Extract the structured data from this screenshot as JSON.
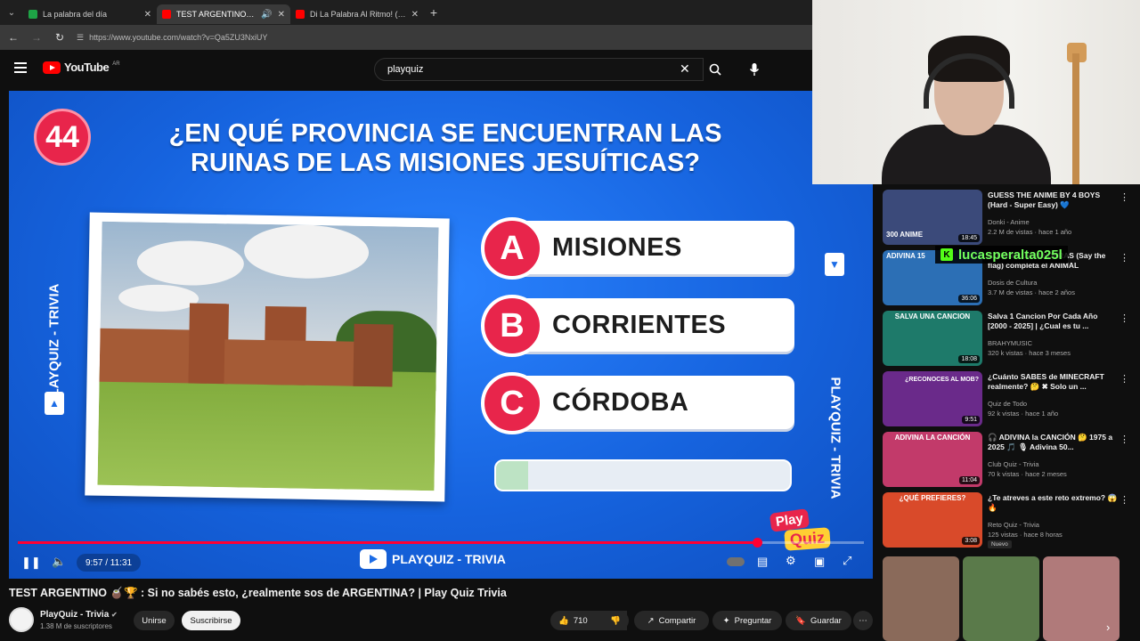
{
  "browser": {
    "tabs": [
      {
        "label": "La palabra del día",
        "color": "#1ea446"
      },
      {
        "label": "TEST ARGENTINO 🧉🏆 : S",
        "color": "#ff0000"
      },
      {
        "label": "Di La Palabra Al Ritmo! (Say Th",
        "color": "#ff0000"
      }
    ],
    "new_tab": "+",
    "url": "https://www.youtube.com/watch?v=Qa5ZU3NxiUY"
  },
  "youtube": {
    "logo": "YouTube",
    "country": "AR",
    "search_value": "playquiz"
  },
  "video": {
    "question_number": "44",
    "question_line1": "¿EN QUÉ PROVINCIA SE ENCUENTRAN LAS",
    "question_line2": "RUINAS DE LAS MISIONES JESUÍTICAS?",
    "side_text": "PLAYQUIZ - TRIVIA",
    "answers": [
      {
        "letter": "A",
        "text": "MISIONES"
      },
      {
        "letter": "B",
        "text": "CORRIENTES"
      },
      {
        "letter": "C",
        "text": "CÓRDOBA"
      }
    ],
    "timer_fraction": 0.11,
    "logo_line1": "Play",
    "logo_line2": "Quiz",
    "progress_fraction": 0.874,
    "time": "9:57 / 11:31",
    "channel_chip": "PLAYQUIZ - TRIVIA"
  },
  "below": {
    "title": "TEST ARGENTINO 🧉🏆 : Si no sabés esto, ¿realmente sos de ARGENTINA? | Play Quiz Trivia",
    "channel": "PlayQuiz - Trivia",
    "subscribers": "1.38 M de suscriptores",
    "join": "Unirse",
    "subscribe": "Suscribirse",
    "likes": "710",
    "share": "Compartir",
    "ask": "Preguntar",
    "save": "Guardar"
  },
  "overlay_username": "lucasperalta025l",
  "recommendations": [
    {
      "title": "GUESS THE ANIME BY 4 BOYS (Hard - Super Easy) 💙",
      "channel": "Donki - Anime",
      "meta": "2.2 M de vistas · hace 1 año",
      "duration": "18:45",
      "thumb_text": "300 ANIME",
      "thumb_color": "#3b4a7a"
    },
    {
      "title": "ADIVINA 15 BANDERAS (Say the flag) completa el ANIMAL",
      "channel": "Dosis de Cultura",
      "meta": "3.7 M de vistas · hace 2 años",
      "duration": "36:06",
      "thumb_text": "ADIVINA 15",
      "thumb_color": "#2c6fb5"
    },
    {
      "title": "Salva 1 Cancion Por Cada Año [2000 - 2025] | ¿Cual es tu ...",
      "channel": "BRAHYMUSIC",
      "meta": "320 k vistas · hace 3 meses",
      "duration": "18:08",
      "thumb_text": "SALVA UNA CANCION",
      "thumb_color": "#1e7a6a"
    },
    {
      "title": "¿Cuánto SABES de MINECRAFT realmente? 🤔 ✖ Solo un ...",
      "channel": "Quiz de Todo",
      "meta": "92 k vistas · hace 1 año",
      "duration": "9:51",
      "thumb_text": "¿RECONOCES AL MOB?",
      "thumb_color": "#6a2a8a"
    },
    {
      "title": "🎧 ADIVINA la CANCIÓN 🤔 1975 a 2025 🎵 🎙 Adivina 50...",
      "channel": "Club Quiz - Trivia",
      "meta": "70 k vistas · hace 2 meses",
      "duration": "11:04",
      "thumb_text": "ADIVINA LA CANCIÓN",
      "thumb_color": "#c23a6a"
    },
    {
      "title": "¿Te atreves a este reto extremo? 😱 🔥",
      "channel": "Reto Quiz - Trivia",
      "meta": "125 vistas · hace 8 horas",
      "duration": "3:08",
      "badge": "Nuevo",
      "thumb_text": "¿QUÉ PREFIERES?",
      "thumb_color": "#d94a2a"
    }
  ],
  "shorts_colors": [
    "#8a6a5a",
    "#5a7a4a",
    "#b07a7a"
  ]
}
